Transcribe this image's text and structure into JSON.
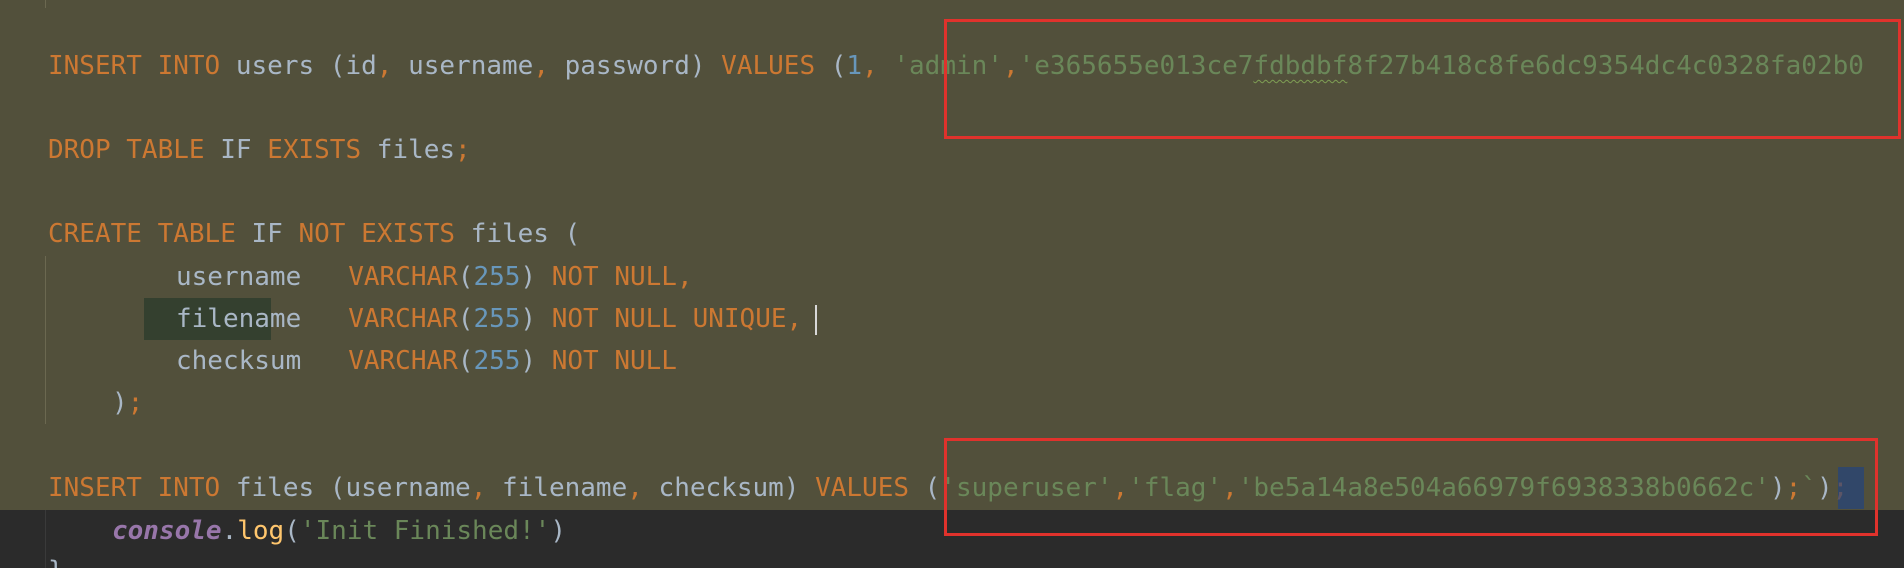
{
  "editor": {
    "line1": {
      "kw_insert": "INSERT",
      "kw_into": "INTO",
      "table": "users",
      "paren_open": "(",
      "col_id": "id",
      "comma1": ",",
      "col_username": "username",
      "comma2": ",",
      "col_password": "password",
      "paren_close": ")",
      "kw_values": "VALUES",
      "values_open": "(",
      "value_id": "1",
      "comma3": ",",
      "value_admin": "'admin'",
      "comma4": ",",
      "value_hash_a": "'e365655e013ce7",
      "value_hash_squiggle": "fdbdbf",
      "value_hash_b": "8f27b418c8fe6dc9354dc4c0328fa02b0"
    },
    "line2": {
      "kw_drop": "DROP",
      "kw_table": "TABLE",
      "kw_if": "IF",
      "kw_exists": "EXISTS",
      "table": "files",
      "semicolon": ";"
    },
    "line3": {
      "kw_create": "CREATE",
      "kw_table": "TABLE",
      "kw_if": "IF",
      "kw_not": "NOT",
      "kw_exists": "EXISTS",
      "table": "files",
      "paren_open": "("
    },
    "line4": {
      "column": "username",
      "type": "VARCHAR",
      "open": "(",
      "size": "255",
      "close": ")",
      "constraint": "NOT NULL,"
    },
    "line5": {
      "column": "filename",
      "type": "VARCHAR",
      "open": "(",
      "size": "255",
      "close": ")",
      "constraint": "NOT NULL UNIQUE,"
    },
    "line6": {
      "column": "checksum",
      "type": "VARCHAR",
      "open": "(",
      "size": "255",
      "close": ")",
      "constraint": "NOT NULL"
    },
    "line7": {
      "paren_close": ")",
      "semicolon": ";"
    },
    "line8": {
      "kw_insert": "INSERT",
      "kw_into": "INTO",
      "table": "files",
      "paren_open": "(",
      "col_username": "username",
      "comma1": ",",
      "col_filename": "filename",
      "comma2": ",",
      "col_checksum": "checksum",
      "paren_close": ")",
      "kw_values": "VALUES",
      "values_open": "(",
      "value_superuser": "'superuser'",
      "comma3": ",",
      "value_flag": "'flag'",
      "comma4": ",",
      "value_checksum": "'be5a14a8e504a66979f6938338b0662c'",
      "values_close": ")",
      "semicolon": ";",
      "backtick": "`",
      "close_paren": ")",
      "final_semicolon": ";"
    },
    "line9": {
      "object": "console",
      "dot": ".",
      "method": "log",
      "open": "(",
      "message": "'Init Finished!'",
      "close": ")"
    },
    "line10": {
      "brace": "}"
    }
  }
}
